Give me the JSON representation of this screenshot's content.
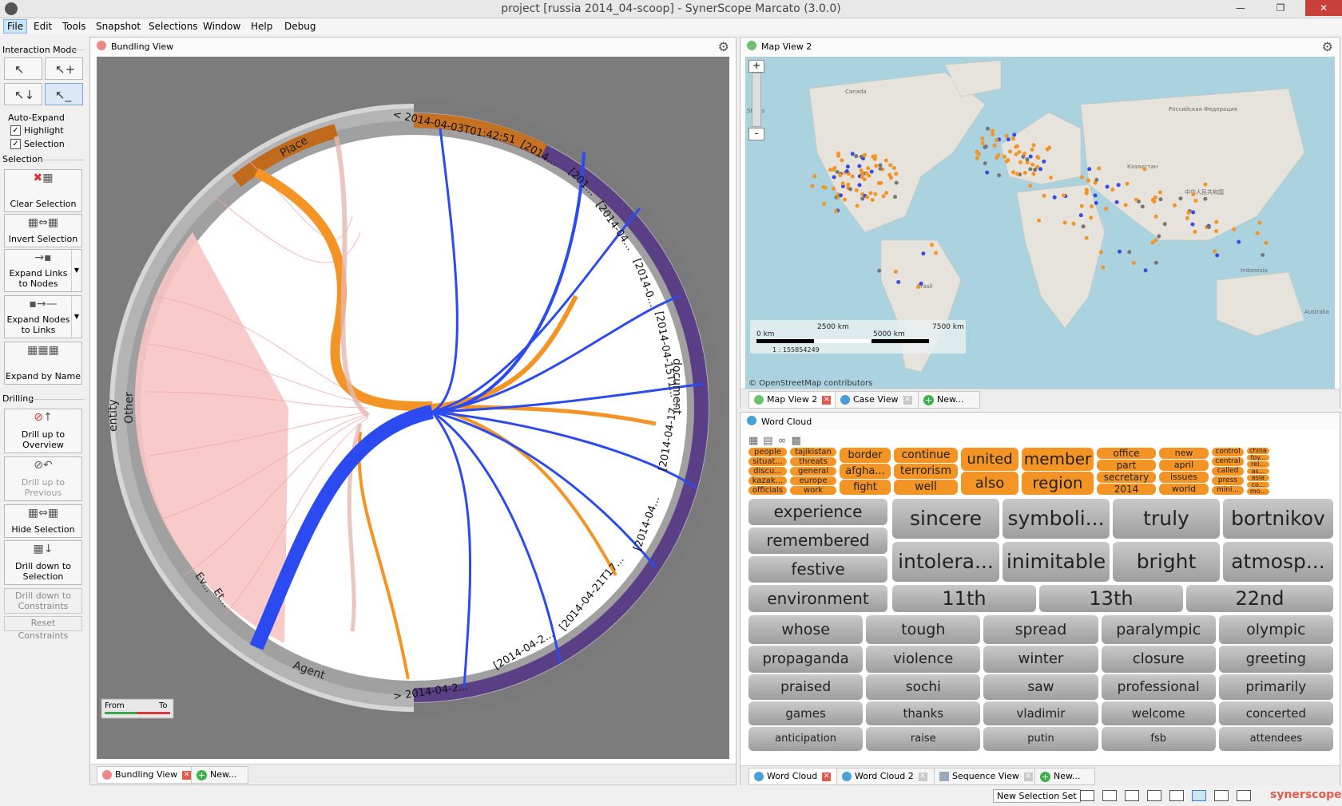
{
  "window": {
    "title": "project [russia 2014_04-scoop] - SynerScope Marcato (3.0.0)"
  },
  "menu": [
    "File",
    "Edit",
    "Tools",
    "Snapshot",
    "Selections",
    "Window",
    "Help",
    "Debug"
  ],
  "left": {
    "interaction_mode": "Interaction Mode",
    "auto_expand": "Auto-Expand",
    "highlight": "Highlight",
    "selection_chk": "Selection",
    "selection_section": "Selection",
    "clear_selection": "Clear Selection",
    "invert_selection": "Invert Selection",
    "expand_links": "Expand Links to Nodes",
    "expand_nodes": "Expand Nodes to Links",
    "expand_by_name": "Expand by Name",
    "drilling": "Drilling",
    "drill_up_overview": "Drill up to Overview",
    "drill_up_previous": "Drill up to Previous",
    "hide_selection": "Hide Selection",
    "drill_down_selection": "Drill down to Selection",
    "drill_down_constraints": "Drill down to Constraints",
    "reset_constraints": "Reset Constraints"
  },
  "bundling": {
    "title": "Bundling View",
    "labels": {
      "place": "Place",
      "entity": "entity",
      "other": "Other",
      "agent": "Agent",
      "ev": "Ev...",
      "et": "Et...",
      "document": "document",
      "d1": "< 2014-04-03T01:42:51",
      "d2": "[2014...",
      "d3": "[201...",
      "d4": "[2014-04...",
      "d5": "[2014-0...",
      "d6": "[2014-04-15T1...",
      "d7": "[2014-04-17...",
      "d8": "[2014-04...",
      "d9": "[2014-04-21T17...",
      "d10": "[2014-04-2...",
      "d11": "> 2014-04-2..."
    },
    "legend": {
      "from": "From",
      "to": "To"
    },
    "tabs": [
      "Bundling View",
      "New..."
    ]
  },
  "map": {
    "title": "Map View 2",
    "zoom_in": "+",
    "zoom_out": "-",
    "scale": {
      "s0": "0 km",
      "s1": "2500 km",
      "s2": "5000 km",
      "s3": "7500 km",
      "ratio": "1 : 155854249"
    },
    "attribution": "© OpenStreetMap contributors",
    "places": {
      "canada": "Canada",
      "states": "States",
      "russia": "Российская Федерация",
      "kazakhstan": "Казахстан",
      "china": "中华人民共和国",
      "brasil": "Brasil",
      "indonesia": "Indonesia",
      "australia": "Australia"
    },
    "tabs": [
      "Map View 2",
      "Case View",
      "New..."
    ]
  },
  "wordcloud": {
    "title": "Word Cloud",
    "small_words": [
      "people",
      "situat...",
      "discu...",
      "kazak...",
      "officials",
      "tajikistan",
      "threats",
      "general",
      "europe",
      "work",
      "border",
      "afgha...",
      "fight",
      "continue",
      "terrorism",
      "well",
      "united",
      "also",
      "member",
      "region",
      "office",
      "part",
      "secretary",
      "2014",
      "new",
      "april",
      "issues",
      "world",
      "control",
      "central",
      "called",
      "press",
      "mini...",
      "china",
      "foy...",
      "rel...",
      "as...",
      "asia",
      "co...",
      "mo..."
    ],
    "rows": [
      [
        "experience",
        "remembered",
        "festive",
        "sincere",
        "symboli...",
        "truly",
        "bortnikov",
        "intolera...",
        "inimitable",
        "bright",
        "atmosp..."
      ],
      [
        "environment",
        "11th",
        "13th",
        "22nd"
      ],
      [
        "whose",
        "tough",
        "spread",
        "paralympic",
        "olympic"
      ],
      [
        "propaganda",
        "violence",
        "winter",
        "closure",
        "greeting"
      ],
      [
        "praised",
        "sochi",
        "saw",
        "professional",
        "primarily"
      ],
      [
        "games",
        "thanks",
        "vladimir",
        "welcome",
        "concerted"
      ],
      [
        "anticipation",
        "raise",
        "putin",
        "fsb",
        "attendees"
      ]
    ],
    "tabs": [
      "Word Cloud",
      "Word Cloud 2",
      "Sequence View",
      "New..."
    ]
  },
  "status": {
    "new_selection_set": "New Selection Set",
    "brand": "synerscope"
  },
  "colors": {
    "orange": "#f39424",
    "blue": "#2b4af0",
    "pink": "#f4a7a7",
    "purple": "#5a3f86",
    "accent": "#e25a4c"
  }
}
